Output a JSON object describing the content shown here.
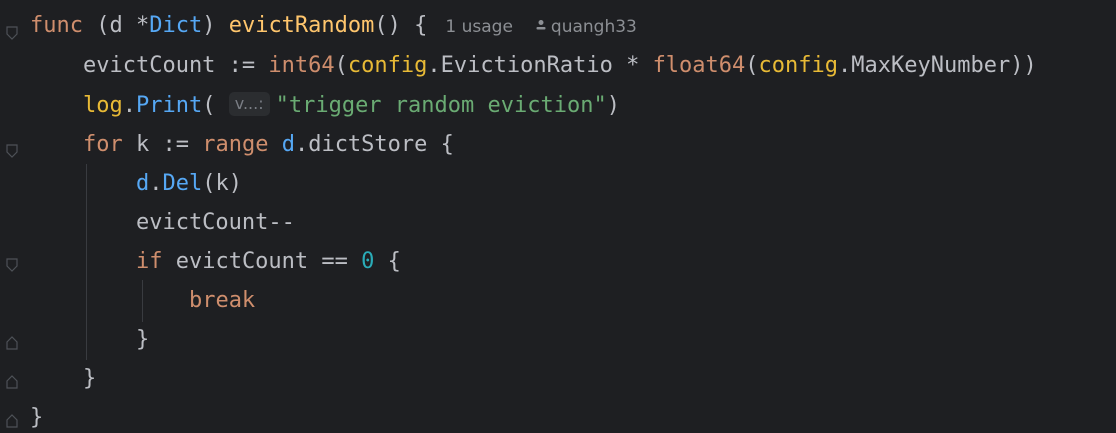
{
  "editor": {
    "language": "Go",
    "theme_colors": {
      "background": "#1e1f22",
      "keyword": "#cf8e6d",
      "function_decl": "#ffc66d",
      "function_call": "#56a8f5",
      "string": "#6aab73",
      "number": "#2aacb8",
      "default_text": "#bcbec4",
      "hint": "#8c8f94"
    },
    "header_hints": {
      "usages": "1 usage",
      "author": "quangh33"
    },
    "inlay_param_hint": "v...:",
    "lines": [
      {
        "tokens": [
          {
            "t": "func",
            "c": "c-orange"
          },
          {
            "t": " (d ",
            "c": "c-field"
          },
          {
            "t": "*",
            "c": "c-field"
          },
          {
            "t": "Dict",
            "c": "c-teal"
          },
          {
            "t": ") ",
            "c": "c-field"
          },
          {
            "t": "evictRandom",
            "c": "c-yellow"
          },
          {
            "t": "() {",
            "c": "c-field"
          }
        ]
      },
      {
        "tokens": [
          {
            "t": "    evictCount := ",
            "c": "c-field"
          },
          {
            "t": "int64",
            "c": "c-orange"
          },
          {
            "t": "(",
            "c": "c-field"
          },
          {
            "t": "config",
            "c": "c-method"
          },
          {
            "t": ".EvictionRatio * ",
            "c": "c-field"
          },
          {
            "t": "float64",
            "c": "c-orange"
          },
          {
            "t": "(",
            "c": "c-field"
          },
          {
            "t": "config",
            "c": "c-method"
          },
          {
            "t": ".MaxKeyNumber))",
            "c": "c-field"
          }
        ]
      },
      {
        "tokens": [
          {
            "t": "    ",
            "c": "c-field"
          },
          {
            "t": "log",
            "c": "c-method"
          },
          {
            "t": ".",
            "c": "c-field"
          },
          {
            "t": "Print",
            "c": "c-teal"
          },
          {
            "t": "( ",
            "c": "c-field"
          },
          {
            "t": "__INLAY__",
            "c": ""
          },
          {
            "t": "\"trigger random eviction\"",
            "c": "c-green"
          },
          {
            "t": ")",
            "c": "c-field"
          }
        ]
      },
      {
        "tokens": [
          {
            "t": "    ",
            "c": "c-field"
          },
          {
            "t": "for",
            "c": "c-orange"
          },
          {
            "t": " k := ",
            "c": "c-field"
          },
          {
            "t": "range",
            "c": "c-orange"
          },
          {
            "t": " d",
            "c": "c-teal"
          },
          {
            "t": ".dictStore {",
            "c": "c-field"
          }
        ]
      },
      {
        "tokens": [
          {
            "t": "        ",
            "c": "c-field"
          },
          {
            "t": "d",
            "c": "c-teal"
          },
          {
            "t": ".",
            "c": "c-field"
          },
          {
            "t": "Del",
            "c": "c-teal"
          },
          {
            "t": "(k)",
            "c": "c-field"
          }
        ]
      },
      {
        "tokens": [
          {
            "t": "        evictCount--",
            "c": "c-field"
          }
        ]
      },
      {
        "tokens": [
          {
            "t": "        ",
            "c": "c-field"
          },
          {
            "t": "if",
            "c": "c-orange"
          },
          {
            "t": " evictCount == ",
            "c": "c-field"
          },
          {
            "t": "0",
            "c": "c-num"
          },
          {
            "t": " {",
            "c": "c-field"
          }
        ]
      },
      {
        "tokens": [
          {
            "t": "            ",
            "c": "c-field"
          },
          {
            "t": "break",
            "c": "c-orange"
          }
        ]
      },
      {
        "tokens": [
          {
            "t": "        }",
            "c": "c-field"
          }
        ]
      },
      {
        "tokens": [
          {
            "t": "    }",
            "c": "c-field"
          }
        ]
      },
      {
        "tokens": [
          {
            "t": "}",
            "c": "c-field"
          }
        ]
      }
    ]
  }
}
